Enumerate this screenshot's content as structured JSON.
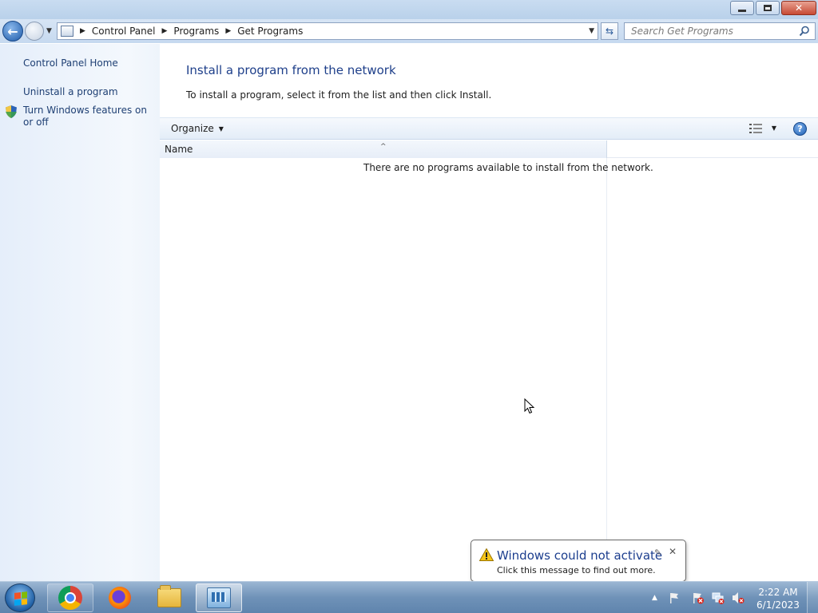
{
  "window": {
    "controls": {
      "minimize": "minimize",
      "restore": "restore",
      "close": "close"
    }
  },
  "address_bar": {
    "breadcrumbs": [
      "Control Panel",
      "Programs",
      "Get Programs"
    ]
  },
  "search": {
    "placeholder": "Search Get Programs"
  },
  "left_pane": {
    "links": [
      {
        "label": "Control Panel Home"
      },
      {
        "label": "Uninstall a program"
      },
      {
        "label": "Turn Windows features on or off",
        "icon": "shield-icon"
      }
    ]
  },
  "main": {
    "title": "Install a program from the network",
    "instruction": "To install a program, select it from the list and then click Install.",
    "toolbar": {
      "organize_label": "Organize"
    },
    "list": {
      "columns": [
        "Name"
      ],
      "empty_message": "There are no programs available to install from the network."
    }
  },
  "notification": {
    "title": "Windows could not activate",
    "message": "Click this message to find out more."
  },
  "taskbar": {
    "apps": [
      "chrome-icon",
      "firefox-icon",
      "file-explorer-icon",
      "control-panel-icon"
    ],
    "tray_icons": [
      "action-center-flag-icon",
      "network-icon",
      "volume-muted-icon"
    ],
    "clock": {
      "time": "2:22 AM",
      "date": "6/1/2023"
    }
  },
  "colors": {
    "link_blue": "#1e3f73",
    "title_blue": "#1e3f8a",
    "taskbar_blue": "#6f92b8"
  }
}
